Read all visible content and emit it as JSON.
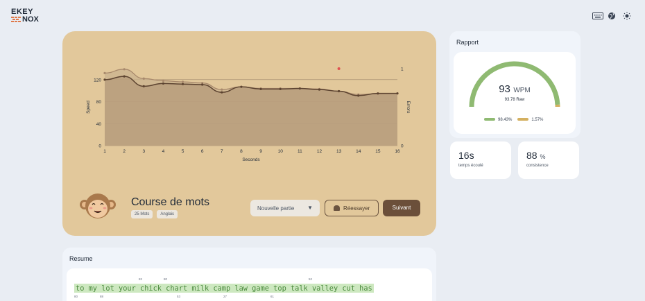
{
  "logo": {
    "line1": "EKEY",
    "line2": "NOX"
  },
  "header": {
    "icons": [
      "keyboard-icon",
      "globe-icon",
      "sun-icon"
    ]
  },
  "game": {
    "title": "Course de mots",
    "tags": [
      "25 Mots",
      "Anglais"
    ],
    "mode_select": "Nouvelle partie",
    "retry_label": "Réessayer",
    "next_label": "Suivant"
  },
  "chart_data": {
    "type": "area",
    "xlabel": "Seconds",
    "ylabel": "Speed",
    "y2label": "Errors",
    "x": [
      1,
      2,
      3,
      4,
      5,
      6,
      7,
      8,
      9,
      10,
      11,
      12,
      13,
      14,
      15,
      16
    ],
    "xlim": [
      1,
      16
    ],
    "ylim": [
      0,
      140
    ],
    "y2lim": [
      0,
      1
    ],
    "yticks": [
      0,
      40,
      80,
      120
    ],
    "y2ticks": [
      0,
      1
    ],
    "series": [
      {
        "values": [
          132,
          139,
          122,
          118,
          116,
          114,
          102,
          107,
          104,
          104,
          104,
          103,
          99,
          93,
          94,
          95
        ]
      },
      {
        "values": [
          120,
          126,
          108,
          113,
          112,
          111,
          97,
          107,
          103,
          103,
          104,
          102,
          99,
          91,
          95,
          95
        ]
      }
    ],
    "errors": [
      {
        "x": 13,
        "y": 1
      }
    ],
    "colors": {
      "raw": "#a8896c",
      "wpm": "#5c4330",
      "error": "#e05252",
      "fill": "#c2a888"
    },
    "grid": true
  },
  "rapport": {
    "title": "Rapport",
    "wpm": "93",
    "wpm_unit": "WPM",
    "raw": "93.78 Raw",
    "accuracy": "98.43%",
    "error_rate": "1.57%",
    "accuracy_fraction": 0.9843,
    "colors": {
      "accuracy": "#8fba72",
      "error": "#d4b060"
    }
  },
  "stats": {
    "time": {
      "value": "16s",
      "label": "temps écoulé"
    },
    "consistency": {
      "value": "88",
      "unit": "%",
      "label": "consistence"
    }
  },
  "resume": {
    "title": "Resume",
    "words": "to my lot your chick chart milk camp law game top talk valley cut has",
    "marks_top": [
      "82",
      "80",
      "52"
    ],
    "marks_bottom": [
      "80",
      "88",
      "53",
      "27",
      "61"
    ]
  }
}
